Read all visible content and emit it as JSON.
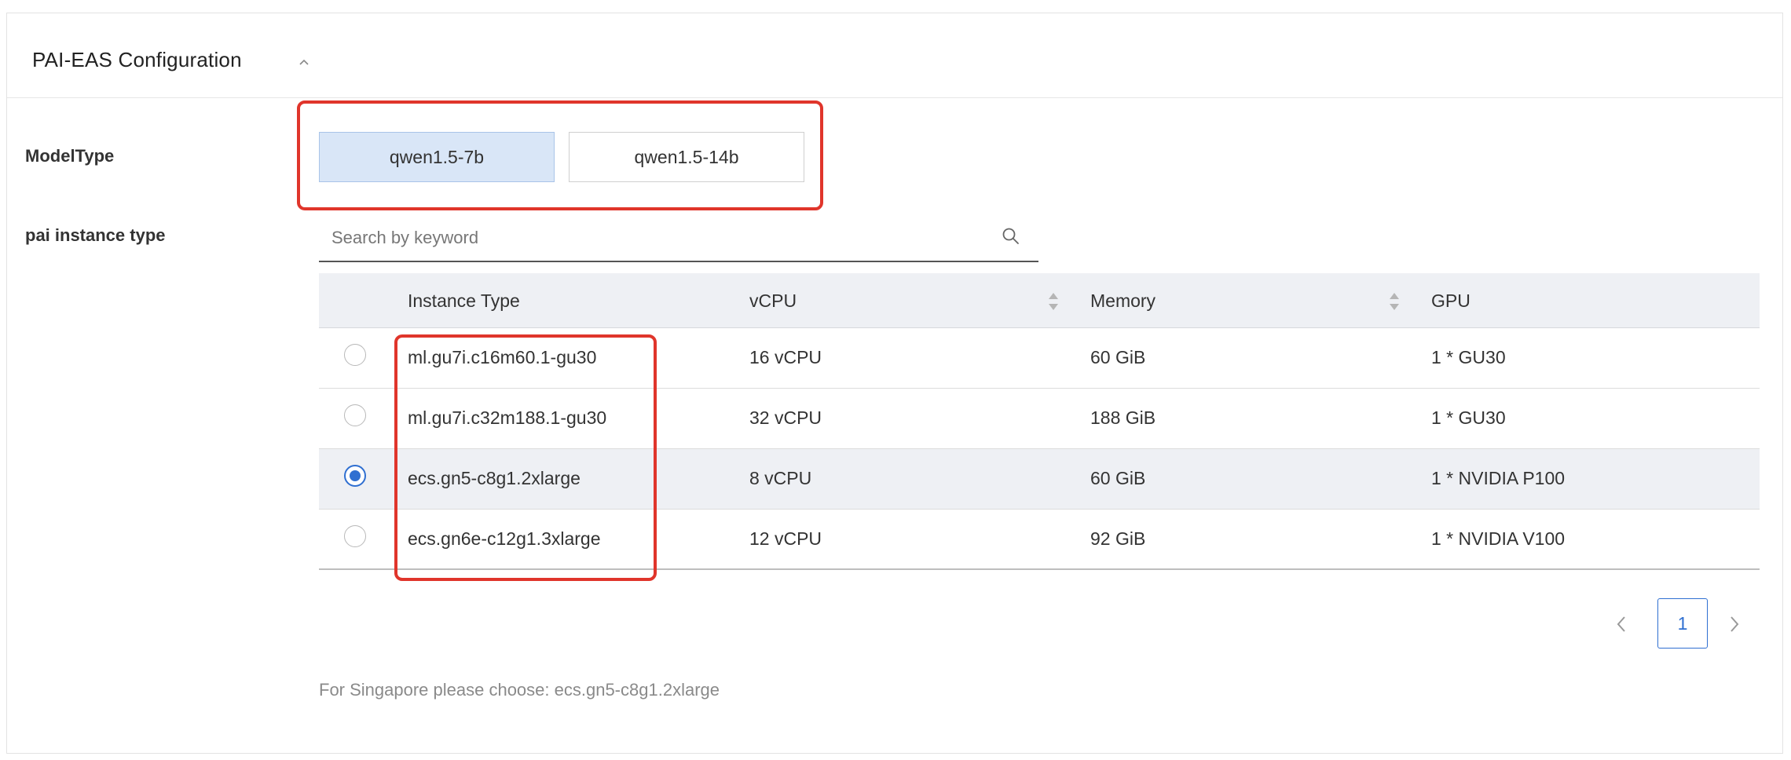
{
  "panel": {
    "title": "PAI-EAS Configuration",
    "collapse_icon": "chevron-up-icon"
  },
  "model_type": {
    "label": "ModelType",
    "options": [
      {
        "label": "qwen1.5-7b",
        "selected": true
      },
      {
        "label": "qwen1.5-14b",
        "selected": false
      }
    ]
  },
  "instance_type": {
    "label": "pai instance type",
    "search": {
      "placeholder": "Search by keyword",
      "value": "",
      "icon": "search-icon"
    },
    "columns": [
      "Instance Type",
      "vCPU",
      "Memory",
      "GPU"
    ],
    "sortable_columns": [
      "vCPU",
      "Memory"
    ],
    "rows": [
      {
        "instance_type": "ml.gu7i.c16m60.1-gu30",
        "vcpu": "16 vCPU",
        "memory": "60 GiB",
        "gpu": "1 * GU30",
        "selected": false
      },
      {
        "instance_type": "ml.gu7i.c32m188.1-gu30",
        "vcpu": "32 vCPU",
        "memory": "188 GiB",
        "gpu": "1 * GU30",
        "selected": false
      },
      {
        "instance_type": "ecs.gn5-c8g1.2xlarge",
        "vcpu": "8 vCPU",
        "memory": "60 GiB",
        "gpu": "1 * NVIDIA P100",
        "selected": true
      },
      {
        "instance_type": "ecs.gn6e-c12g1.3xlarge",
        "vcpu": "12 vCPU",
        "memory": "92 GiB",
        "gpu": "1 * NVIDIA V100",
        "selected": false
      }
    ],
    "pagination": {
      "current_page": "1",
      "prev_icon": "chevron-left-icon",
      "next_icon": "chevron-right-icon"
    },
    "hint": "For Singapore please choose: ecs.gn5-c8g1.2xlarge"
  },
  "colors": {
    "accent": "#2f6fd1",
    "annotation_red": "#e0352b",
    "selected_button_bg": "#d9e6f7",
    "table_header_bg": "#eef0f4"
  }
}
